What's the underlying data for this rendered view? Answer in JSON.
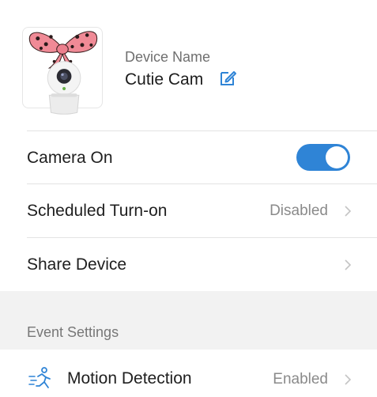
{
  "device": {
    "name_label": "Device Name",
    "name": "Cutie Cam"
  },
  "settings": [
    {
      "label": "Camera On",
      "toggle_on": true
    },
    {
      "label": "Scheduled Turn-on",
      "value": "Disabled"
    },
    {
      "label": "Share Device"
    }
  ],
  "event_settings": {
    "title": "Event Settings",
    "motion_detection": {
      "label": "Motion Detection",
      "value": "Enabled"
    }
  },
  "colors": {
    "accent": "#2f84d6",
    "edit_icon": "#2f84d6",
    "bow": "#f08a96",
    "bow_dots": "#2a1a1a"
  }
}
